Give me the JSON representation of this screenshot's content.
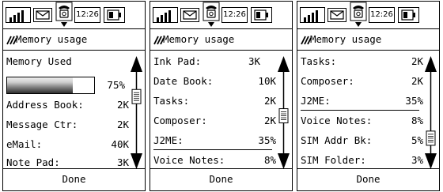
{
  "screens": [
    {
      "status": {
        "time": "12:26"
      },
      "title": "Memory usage",
      "section_label": "Memory Used",
      "progress": {
        "fraction": 0.75,
        "label": "75%"
      },
      "items": [
        {
          "label": "Address Book:",
          "value": "2K"
        },
        {
          "label": "Message Ctr:",
          "value": "2K"
        },
        {
          "label": "eMail:",
          "value": "40K"
        },
        {
          "label": "Note Pad:",
          "value": "3K"
        }
      ],
      "scroll_position": 0.25,
      "done_label": "Done"
    },
    {
      "status": {
        "time": "12:26"
      },
      "title": "Memory usage",
      "items": [
        {
          "label": "Ink Pad:",
          "value": "3K"
        },
        {
          "label": "Date Book:",
          "value": "10K"
        },
        {
          "label": "Tasks:",
          "value": "2K"
        },
        {
          "label": "Composer:",
          "value": "2K"
        },
        {
          "label": "J2ME:",
          "value": "35%"
        },
        {
          "label": "Voice Notes:",
          "value": "8%"
        }
      ],
      "scroll_position": 0.55,
      "done_label": "Done"
    },
    {
      "status": {
        "time": "12:26"
      },
      "title": "Memory usage",
      "items": [
        {
          "label": "Tasks:",
          "value": "2K"
        },
        {
          "label": "Composer:",
          "value": "2K"
        },
        {
          "label": "J2ME:",
          "value": "35%"
        },
        {
          "label": "Voice Notes:",
          "value": "8%"
        },
        {
          "label": "SIM Addr Bk:",
          "value": "5%"
        },
        {
          "label": "SIM Folder:",
          "value": "3%"
        }
      ],
      "scroll_position": 0.9,
      "done_label": "Done"
    }
  ],
  "icons": {
    "signal": "signal-strength-icon",
    "message": "envelope-icon",
    "phone": "phone-icon",
    "battery": "battery-icon",
    "title": "memory-icon",
    "scroll_up": "up-arrow-icon",
    "scroll_down": "down-arrow-icon"
  }
}
